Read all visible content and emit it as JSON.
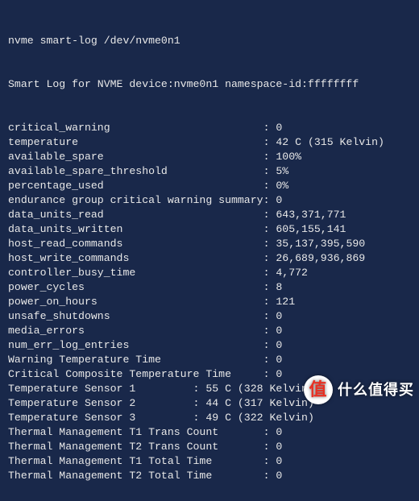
{
  "command": "nvme smart-log /dev/nvme0n1",
  "header": "Smart Log for NVME device:nvme0n1 namespace-id:ffffffff",
  "rows": [
    {
      "label": "critical_warning",
      "pad": 40,
      "value": "0"
    },
    {
      "label": "temperature",
      "pad": 40,
      "value": "42 C (315 Kelvin)"
    },
    {
      "label": "available_spare",
      "pad": 40,
      "value": "100%"
    },
    {
      "label": "available_spare_threshold",
      "pad": 40,
      "value": "5%"
    },
    {
      "label": "percentage_used",
      "pad": 40,
      "value": "0%"
    },
    {
      "label": "endurance group critical warning summary",
      "pad": 40,
      "value": "0"
    },
    {
      "label": "data_units_read",
      "pad": 40,
      "value": "643,371,771"
    },
    {
      "label": "data_units_written",
      "pad": 40,
      "value": "605,155,141"
    },
    {
      "label": "host_read_commands",
      "pad": 40,
      "value": "35,137,395,590"
    },
    {
      "label": "host_write_commands",
      "pad": 40,
      "value": "26,689,936,869"
    },
    {
      "label": "controller_busy_time",
      "pad": 40,
      "value": "4,772"
    },
    {
      "label": "power_cycles",
      "pad": 40,
      "value": "8"
    },
    {
      "label": "power_on_hours",
      "pad": 40,
      "value": "121"
    },
    {
      "label": "unsafe_shutdowns",
      "pad": 40,
      "value": "0"
    },
    {
      "label": "media_errors",
      "pad": 40,
      "value": "0"
    },
    {
      "label": "num_err_log_entries",
      "pad": 40,
      "value": "0"
    },
    {
      "label": "Warning Temperature Time",
      "pad": 40,
      "value": "0"
    },
    {
      "label": "Critical Composite Temperature Time",
      "pad": 40,
      "value": "0"
    },
    {
      "label": "Temperature Sensor 1",
      "pad": 29,
      "value": "55 C (328 Kelvin)"
    },
    {
      "label": "Temperature Sensor 2",
      "pad": 29,
      "value": "44 C (317 Kelvin)"
    },
    {
      "label": "Temperature Sensor 3",
      "pad": 29,
      "value": "49 C (322 Kelvin)"
    },
    {
      "label": "Thermal Management T1 Trans Count",
      "pad": 40,
      "value": "0"
    },
    {
      "label": "Thermal Management T2 Trans Count",
      "pad": 40,
      "value": "0"
    },
    {
      "label": "Thermal Management T1 Total Time",
      "pad": 40,
      "value": "0"
    },
    {
      "label": "Thermal Management T2 Total Time",
      "pad": 40,
      "value": "0"
    }
  ],
  "watermark": {
    "glyph": "值",
    "text": "什么值得买"
  }
}
